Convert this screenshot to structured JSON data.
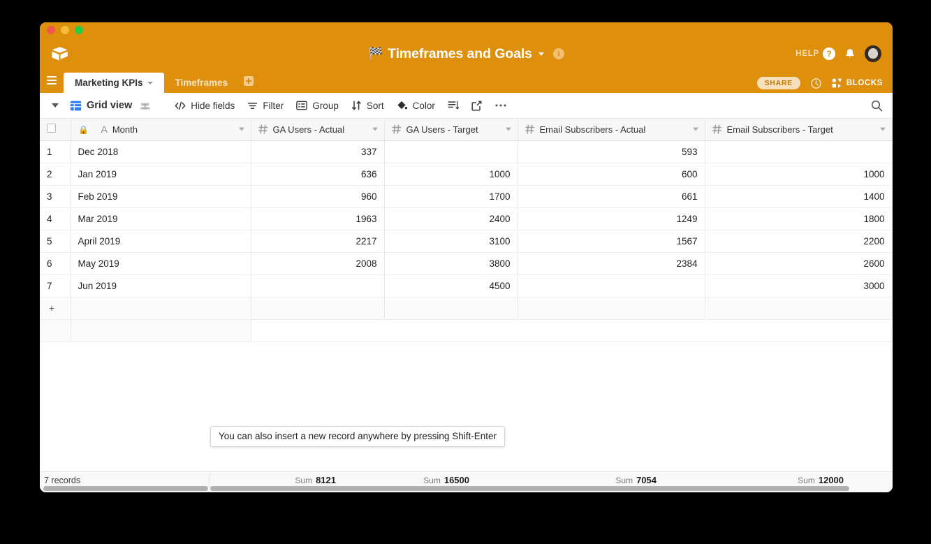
{
  "window": {
    "traffic_lights": [
      "close",
      "minimize",
      "maximize"
    ]
  },
  "header": {
    "logo_icon": "airtable-logo-icon",
    "base_title": "Timeframes and Goals",
    "base_title_emoji": "🏁",
    "base_caret_icon": "chevron-down-icon",
    "info_icon_label": "i",
    "help_label": "HELP",
    "help_icon_label": "?",
    "notification_icon": "bell-icon",
    "avatar": "user-avatar",
    "accent_color": "#DE8F0B"
  },
  "tabs": {
    "menu_icon": "hamburger-menu-icon",
    "items": [
      {
        "label": "Marketing KPIs",
        "active": true
      },
      {
        "label": "Timeframes",
        "active": false
      }
    ],
    "add_tab_icon": "add-table-icon",
    "share_label": "SHARE",
    "history_icon": "history-clock-icon",
    "blocks_label": "BLOCKS",
    "blocks_icon": "blocks-icon"
  },
  "toolbar": {
    "view_caret_icon": "chevron-down-icon",
    "view_icon": "grid-view-icon",
    "view_name": "Grid view",
    "collaborators_icon": "collaborators-icon",
    "buttons": [
      {
        "label": "Hide fields",
        "icon": "hide-fields-icon"
      },
      {
        "label": "Filter",
        "icon": "filter-icon"
      },
      {
        "label": "Group",
        "icon": "group-icon"
      },
      {
        "label": "Sort",
        "icon": "sort-icon"
      },
      {
        "label": "Color",
        "icon": "color-icon"
      }
    ],
    "row_height_icon": "row-height-icon",
    "share_view_icon": "share-view-icon",
    "more_icon": "more-options-icon",
    "search_icon": "search-icon"
  },
  "grid": {
    "select_all_checkbox": "",
    "lock_icon": "lock-icon",
    "columns": [
      {
        "name": "Month",
        "type_icon": "text-field-icon",
        "type_glyph": "A"
      },
      {
        "name": "GA Users - Actual",
        "type_icon": "number-field-icon",
        "type_glyph": "#"
      },
      {
        "name": "GA Users - Target",
        "type_icon": "number-field-icon",
        "type_glyph": "#"
      },
      {
        "name": "Email Subscribers - Actual",
        "type_icon": "number-field-icon",
        "type_glyph": "#"
      },
      {
        "name": "Email Subscribers - Target",
        "type_icon": "number-field-icon",
        "type_glyph": "#"
      }
    ],
    "add_field_label": "+",
    "rows": [
      {
        "n": "1",
        "month": "Dec 2018",
        "ga_actual": "337",
        "ga_target": "",
        "email_actual": "593",
        "email_target": ""
      },
      {
        "n": "2",
        "month": "Jan 2019",
        "ga_actual": "636",
        "ga_target": "1000",
        "email_actual": "600",
        "email_target": "1000"
      },
      {
        "n": "3",
        "month": "Feb 2019",
        "ga_actual": "960",
        "ga_target": "1700",
        "email_actual": "661",
        "email_target": "1400"
      },
      {
        "n": "4",
        "month": "Mar 2019",
        "ga_actual": "1963",
        "ga_target": "2400",
        "email_actual": "1249",
        "email_target": "1800"
      },
      {
        "n": "5",
        "month": "April 2019",
        "ga_actual": "2217",
        "ga_target": "3100",
        "email_actual": "1567",
        "email_target": "2200"
      },
      {
        "n": "6",
        "month": "May 2019",
        "ga_actual": "2008",
        "ga_target": "3800",
        "email_actual": "2384",
        "email_target": "2600"
      },
      {
        "n": "7",
        "month": "Jun 2019",
        "ga_actual": "",
        "ga_target": "4500",
        "email_actual": "",
        "email_target": "3000"
      }
    ],
    "add_row_label": "+"
  },
  "tooltip": {
    "text": "You can also insert a new record anywhere by pressing Shift-Enter"
  },
  "footer": {
    "record_count": "7 records",
    "summaries": [
      {
        "label": "Sum",
        "value": "8121"
      },
      {
        "label": "Sum",
        "value": "16500"
      },
      {
        "label": "Sum",
        "value": "7054"
      },
      {
        "label": "Sum",
        "value": "12000"
      }
    ]
  }
}
